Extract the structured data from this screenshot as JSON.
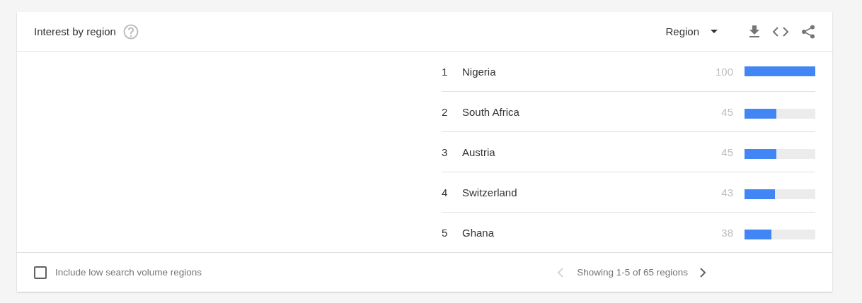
{
  "card": {
    "title": "Interest by region",
    "selector": {
      "label": "Region"
    }
  },
  "rows": [
    {
      "rank": "1",
      "name": "Nigeria",
      "value": "100",
      "level": 1.0
    },
    {
      "rank": "2",
      "name": "South Africa",
      "value": "45",
      "level": 0.45
    },
    {
      "rank": "3",
      "name": "Austria",
      "value": "45",
      "level": 0.45
    },
    {
      "rank": "4",
      "name": "Switzerland",
      "value": "43",
      "level": 0.43
    },
    {
      "rank": "5",
      "name": "Ghana",
      "value": "38",
      "level": 0.38
    }
  ],
  "footer": {
    "checkbox": {
      "label": "Include low search volume regions",
      "checked": false
    },
    "pagination": {
      "text": "Showing 1-5 of 65 regions",
      "prev_disabled": true,
      "next_disabled": false
    }
  }
}
